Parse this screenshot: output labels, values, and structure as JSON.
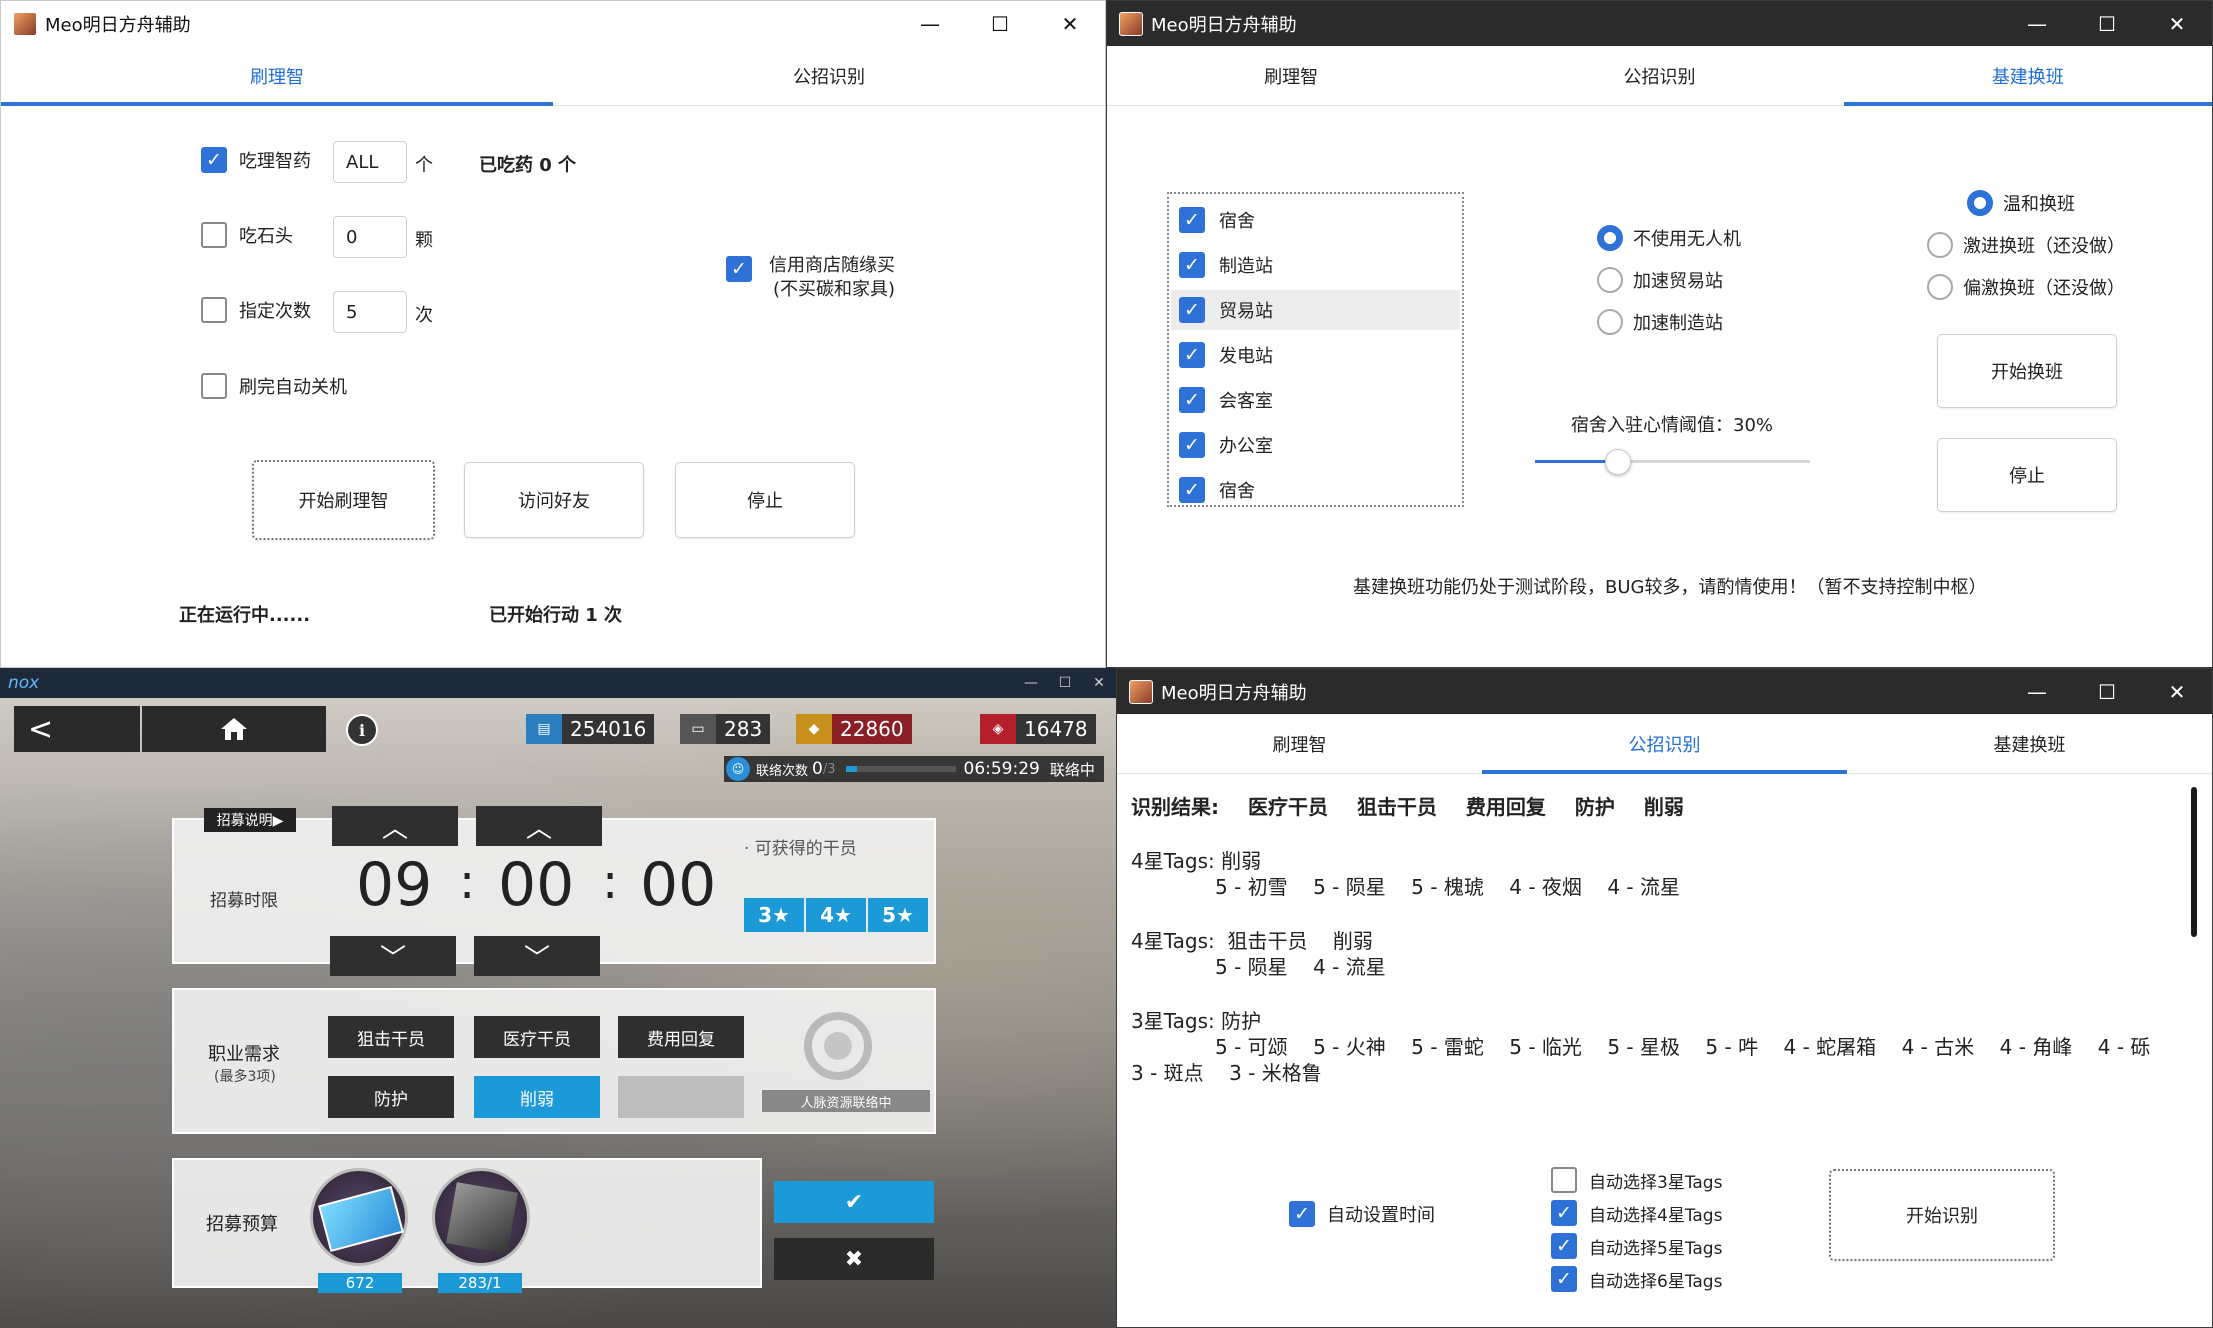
{
  "win1": {
    "title": "Meo明日方舟辅助",
    "min": "—",
    "max": "☐",
    "close": "✕",
    "tabs": [
      "刷理智",
      "公招识别"
    ],
    "eat_potion": "吃理智药",
    "potion_value": "ALL",
    "potion_unit": "个",
    "eaten": "已吃药 0 个",
    "eat_stone": "吃石头",
    "stone_value": "0",
    "stone_unit": "颗",
    "set_times": "指定次数",
    "times_value": "5",
    "times_unit": "次",
    "auto_shutdown": "刷完自动关机",
    "credit_shop_l1": "信用商店随缘买",
    "credit_shop_l2": "(不买碳和家具)",
    "start": "开始刷理智",
    "visit": "访问好友",
    "stop": "停止",
    "status": "正在运行中......",
    "actions": "已开始行动 1 次"
  },
  "win2": {
    "title": "Meo明日方舟辅助",
    "min": "—",
    "max": "☐",
    "close": "✕",
    "tabs": [
      "刷理智",
      "公招识别",
      "基建换班"
    ],
    "facilities": [
      "宿舍",
      "制造站",
      "贸易站",
      "发电站",
      "会客室",
      "办公室",
      "宿舍"
    ],
    "drone": [
      "不使用无人机",
      "加速贸易站",
      "加速制造站"
    ],
    "mood_label": "宿舍入驻心情阈值：",
    "mood_value": "30%",
    "mood_fraction": 0.3,
    "modes": [
      "温和换班",
      "激进换班（还没做）",
      "偏激换班（还没做）"
    ],
    "start": "开始换班",
    "stop": "停止",
    "notice": "基建换班功能仍处于测试阶段，BUG较多，请酌情使用！（暂不支持控制中枢）"
  },
  "nox": {
    "logo": "nox",
    "min": "—",
    "max": "☐",
    "close": "✕"
  },
  "game": {
    "back": "<",
    "info": "i",
    "r1": "254016",
    "r2": "283",
    "r3": "22860",
    "r4": "16478",
    "contact_label": "联络次数",
    "contact_value": "0",
    "contact_total": "/3",
    "timer": "06:59:29",
    "contact_status": "联络中",
    "recruit_help": "招募说明▶",
    "time_label": "招募时限",
    "hh": "09",
    "mm": "00",
    "ss": "00",
    "colon": ":",
    "available": "· 可获得的干员",
    "stars": [
      "3★",
      "4★",
      "5★"
    ],
    "req_label": "职业需求",
    "req_sub": "(最多3项)",
    "tags": [
      "狙击干员",
      "医疗干员",
      "费用回复",
      "防护",
      "削弱"
    ],
    "refresh_label": "人脉资源联络中",
    "budget_label": "招募预算",
    "item1_count": "672",
    "item2_count": "283/1",
    "confirm": "✔",
    "cancel": "✖"
  },
  "win4": {
    "title": "Meo明日方舟辅助",
    "min": "—",
    "max": "☐",
    "close": "✕",
    "tabs": [
      "刷理智",
      "公招识别",
      "基建换班"
    ],
    "result_label": "识别结果:",
    "result_tags": [
      "医疗干员",
      "狙击干员",
      "费用回复",
      "防护",
      "削弱"
    ],
    "g1_head": "4星Tags:  削弱",
    "g1_ops": "5 - 初雪    5 - 陨星    5 - 槐琥    4 - 夜烟    4 - 流星",
    "g2_head": "4星Tags:  狙击干员    削弱",
    "g2_ops": "5 - 陨星    4 - 流星",
    "g3_head": "3星Tags:  防护",
    "g3_ops": "5 - 可颂    5 - 火神    5 - 雷蛇    5 - 临光    5 - 星极    5 - 吽    4 - 蛇屠箱    4 - 古米    4 - 角峰    4 - 砾",
    "g3_ops2": "3 - 斑点    3 - 米格鲁",
    "auto_time": "自动设置时间",
    "auto_tags": [
      "自动选择3星Tags",
      "自动选择4星Tags",
      "自动选择5星Tags",
      "自动选择6星Tags"
    ],
    "start": "开始识别"
  }
}
